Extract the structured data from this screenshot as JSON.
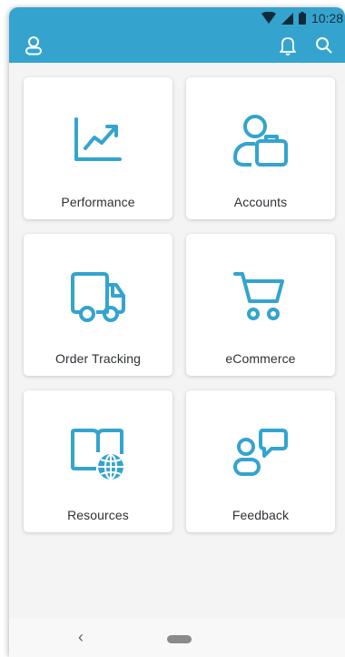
{
  "status_bar": {
    "time": "10:28"
  },
  "app_bar": {
    "accent_color": "#34a4cf",
    "left_icon": "user-icon",
    "right_icons": [
      "bell-icon",
      "search-icon"
    ]
  },
  "tiles": [
    {
      "label": "Performance",
      "icon": "chart-trend-icon"
    },
    {
      "label": "Accounts",
      "icon": "user-briefcase-icon"
    },
    {
      "label": "Order Tracking",
      "icon": "truck-icon"
    },
    {
      "label": "eCommerce",
      "icon": "shopping-cart-icon"
    },
    {
      "label": "Resources",
      "icon": "book-globe-icon"
    },
    {
      "label": "Feedback",
      "icon": "user-chat-icon"
    }
  ],
  "nav_bar": {
    "back_symbol": "‹"
  }
}
